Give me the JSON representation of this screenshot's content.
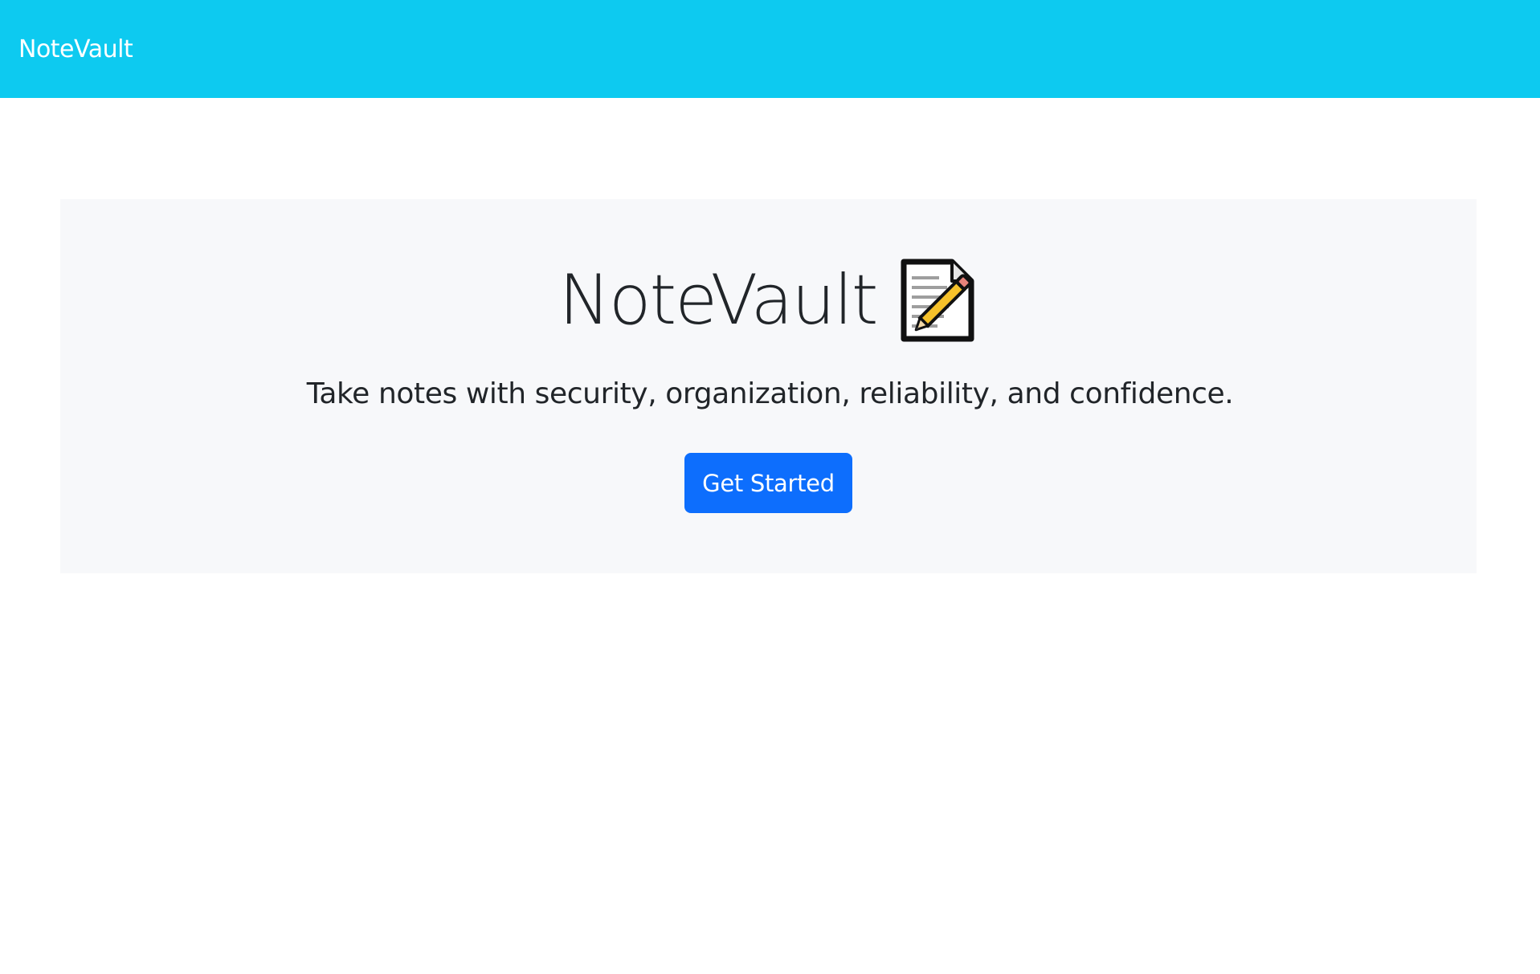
{
  "navbar": {
    "brand": "NoteVault",
    "background_color": "#0dcaf0"
  },
  "hero": {
    "title": "NoteVault",
    "title_icon": "memo-icon",
    "subtitle": "Take notes with security, organization, reliability, and confidence.",
    "cta_label": "Get Started",
    "cta_color": "#0d6efd",
    "background_color": "#f7f8fa"
  }
}
